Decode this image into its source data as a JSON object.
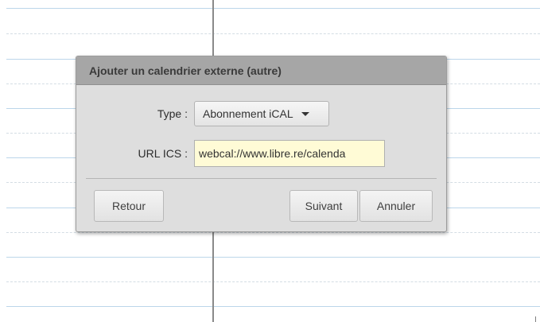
{
  "dialog": {
    "title": "Ajouter un calendrier externe (autre)",
    "type_label": "Type :",
    "type_value": "Abonnement iCAL",
    "url_label": "URL ICS :",
    "url_value": "webcal://www.libre.re/calenda"
  },
  "buttons": {
    "back": "Retour",
    "next": "Suivant",
    "cancel": "Annuler"
  },
  "icons": {
    "select_caret": "caret-down-icon"
  }
}
